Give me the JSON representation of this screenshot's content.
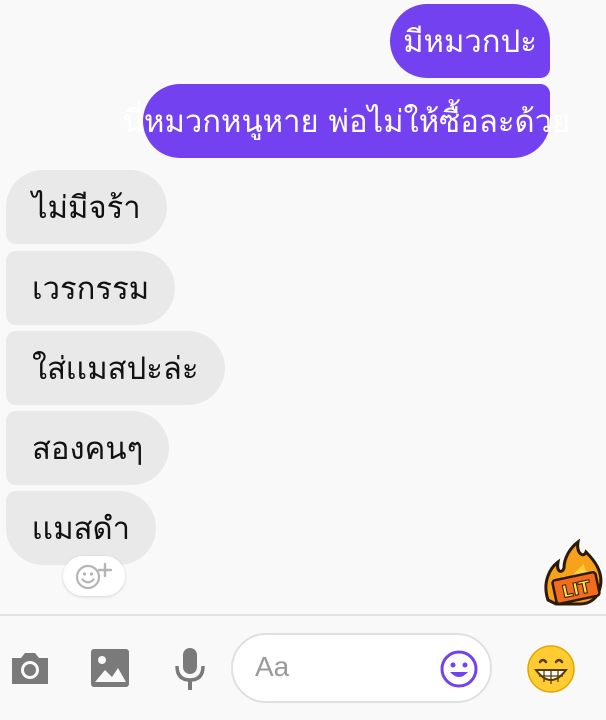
{
  "messages": {
    "outgoing": [
      {
        "text": "มีหมวกปะ"
      },
      {
        "text": "นี่หมวกหนูหาย พ่อไม่ให้ซื้อละด้วย"
      }
    ],
    "incoming": [
      {
        "text": "ไม่มีจร้า"
      },
      {
        "text": "เวรกรรม"
      },
      {
        "text": "ใส่เเมสปะล่ะ"
      },
      {
        "text": "สองคนๆ"
      },
      {
        "text": "เเมสดำ"
      }
    ]
  },
  "sticker": {
    "text": "LIT",
    "icon": "lit-fire-sticker"
  },
  "composer": {
    "placeholder": "Aa"
  },
  "colors": {
    "accent": "#7341f0",
    "incoming_bubble": "#e9e9e9",
    "icon_gray": "#7a7a7a"
  }
}
